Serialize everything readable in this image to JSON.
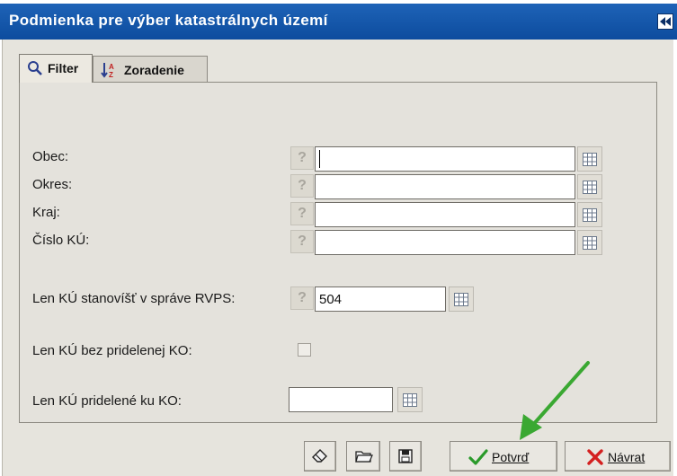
{
  "window": {
    "title": "Podmienka pre výber katastrálnych území"
  },
  "tabs": [
    {
      "label": "Filter",
      "icon": "magnifier-icon",
      "active": true
    },
    {
      "label": "Zoradenie",
      "icon": "sort-az-icon",
      "active": false
    }
  ],
  "fields": {
    "obec": {
      "label": "Obec:",
      "value": ""
    },
    "okres": {
      "label": "Okres:",
      "value": ""
    },
    "kraj": {
      "label": "Kraj:",
      "value": ""
    },
    "cislo_ku": {
      "label": "Číslo KÚ:",
      "value": ""
    },
    "rvps": {
      "label": "Len KÚ stanovíšť v správe RVPS:",
      "value": "504"
    },
    "bez_ko": {
      "label": "Len KÚ bez pridelenej KO:",
      "checked": false
    },
    "ku_ko": {
      "label": "Len KÚ pridelené ku KO:",
      "value": ""
    }
  },
  "help_glyph": "?",
  "toolbar": {
    "confirm_label": "Potvrď",
    "back_label": "Návrat",
    "icons": [
      "eraser-icon",
      "open-folder-icon",
      "save-icon"
    ]
  },
  "colors": {
    "title_bar": "#1558ad",
    "confirm_check": "#2a9a2a",
    "back_x": "#d42020",
    "annotation_arrow": "#3aa832"
  }
}
